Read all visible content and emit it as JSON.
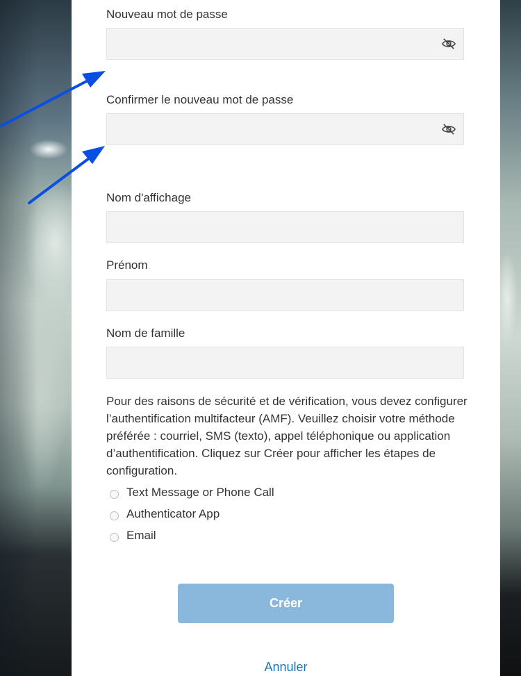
{
  "form": {
    "new_password_label": "Nouveau mot de passe",
    "confirm_password_label": "Confirmer le nouveau mot de passe",
    "display_name_label": "Nom d'affichage",
    "first_name_label": "Prénom",
    "last_name_label": "Nom de famille",
    "new_password_value": "",
    "confirm_password_value": "",
    "display_name_value": "",
    "first_name_value": "",
    "last_name_value": ""
  },
  "mfa": {
    "description": "Pour des raisons de sécurité et de vérification, vous devez configurer l’authentification multifacteur (AMF). Veuillez choisir votre méthode préférée : courriel, SMS (texto), appel téléphonique ou application d’authentification. Cliquez sur Créer pour afficher les étapes de configuration.",
    "options": [
      {
        "label": "Text Message or Phone Call",
        "selected": false
      },
      {
        "label": "Authenticator App",
        "selected": false
      },
      {
        "label": "Email",
        "selected": false
      }
    ]
  },
  "actions": {
    "create_label": "Créer",
    "cancel_label": "Annuler"
  },
  "colors": {
    "accent": "#1f73b7",
    "button_disabled": "#8ab8dc",
    "annotation_arrow": "#0a4fe0",
    "field_bg": "#f3f3f3"
  },
  "icons": {
    "password_toggle": "eye-slash-icon",
    "annotation": "arrow-icon"
  }
}
